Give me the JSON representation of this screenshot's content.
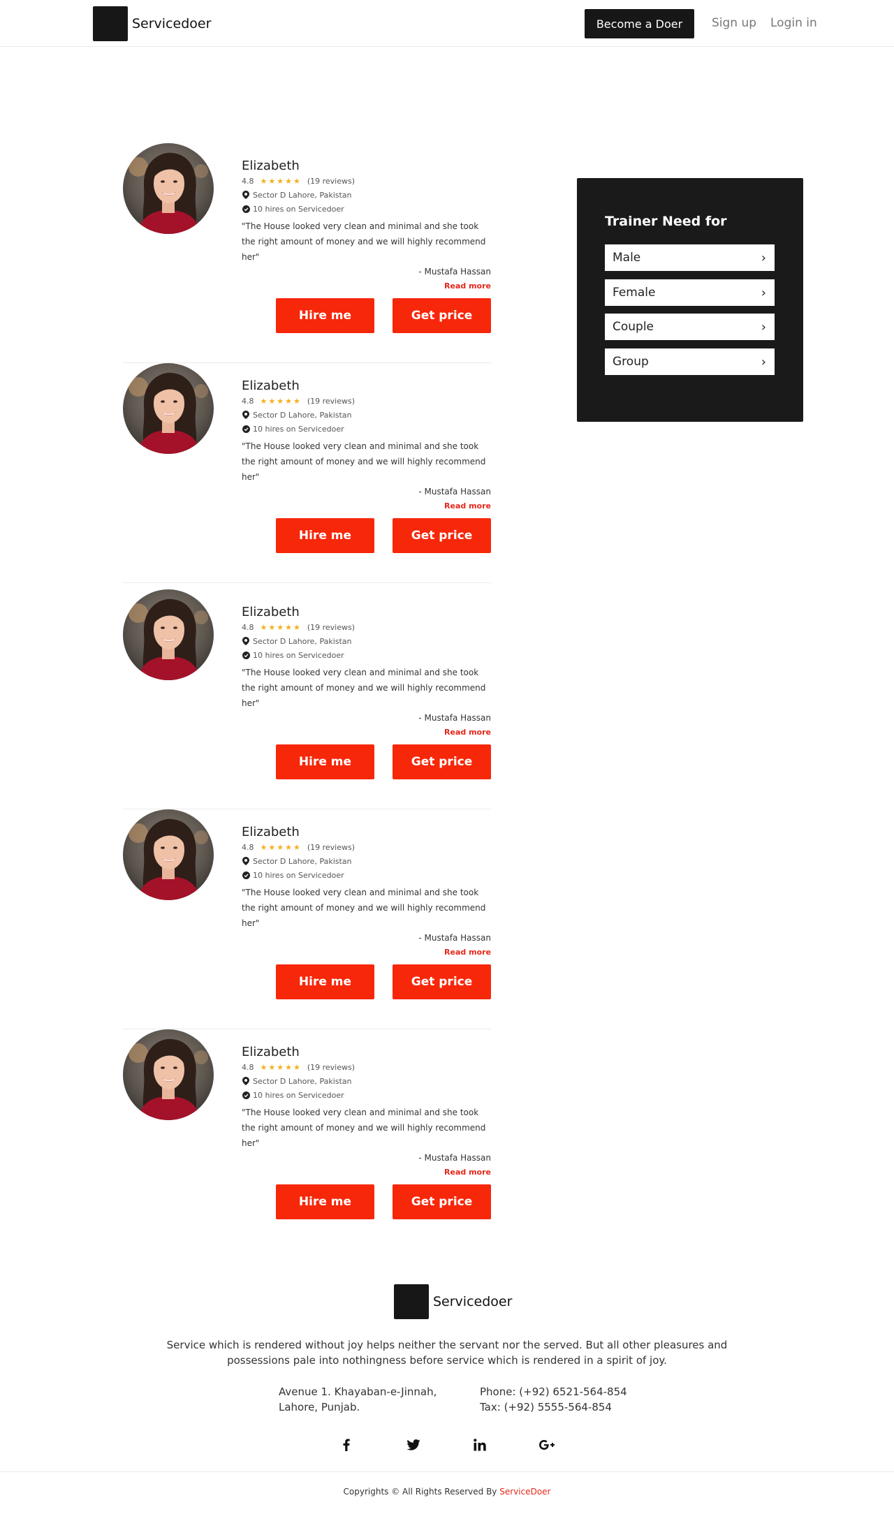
{
  "header": {
    "brand": "Servicedoer",
    "become_label": "Become a Doer",
    "signup_label": "Sign up",
    "login_label": "Login in"
  },
  "profiles": [
    {
      "name": "Elizabeth",
      "rating": "4.8",
      "stars": "★★★★★",
      "reviews": "(19 reviews)",
      "location": "Sector D Lahore, Pakistan",
      "hires": "10 hires on Servicedoer",
      "quote": "\"The House looked very clean and minimal and she took the right amount of money and we will highly recommend her\"",
      "author": "- Mustafa Hassan",
      "read_more": "Read more",
      "hire_label": "Hire me",
      "price_label": "Get price"
    },
    {
      "name": "Elizabeth",
      "rating": "4.8",
      "stars": "★★★★★",
      "reviews": "(19 reviews)",
      "location": "Sector D Lahore, Pakistan",
      "hires": "10 hires on Servicedoer",
      "quote": "\"The House looked very clean and minimal and she took the right amount of money and we will highly recommend her\"",
      "author": "- Mustafa Hassan",
      "read_more": "Read more",
      "hire_label": "Hire me",
      "price_label": "Get price"
    },
    {
      "name": "Elizabeth",
      "rating": "4.8",
      "stars": "★★★★★",
      "reviews": "(19 reviews)",
      "location": "Sector D Lahore, Pakistan",
      "hires": "10 hires on Servicedoer",
      "quote": "\"The House looked very clean and minimal and she took the right amount of money and we will highly recommend her\"",
      "author": "- Mustafa Hassan",
      "read_more": "Read more",
      "hire_label": "Hire me",
      "price_label": "Get price"
    },
    {
      "name": "Elizabeth",
      "rating": "4.8",
      "stars": "★★★★★",
      "reviews": "(19 reviews)",
      "location": "Sector D Lahore, Pakistan",
      "hires": "10 hires on Servicedoer",
      "quote": "\"The House looked very clean and minimal and she took the right amount of money and we will highly recommend her\"",
      "author": "- Mustafa Hassan",
      "read_more": "Read more",
      "hire_label": "Hire me",
      "price_label": "Get price"
    },
    {
      "name": "Elizabeth",
      "rating": "4.8",
      "stars": "★★★★★",
      "reviews": "(19 reviews)",
      "location": "Sector D Lahore, Pakistan",
      "hires": "10 hires on Servicedoer",
      "quote": "\"The House looked very clean and minimal and she took the right amount of money and we will highly recommend her\"",
      "author": "- Mustafa Hassan",
      "read_more": "Read more",
      "hire_label": "Hire me",
      "price_label": "Get price"
    }
  ],
  "sidebar": {
    "title": "Trainer Need for",
    "options": [
      "Male",
      "Female",
      "Couple",
      "Group"
    ]
  },
  "footer": {
    "brand": "Servicedoer",
    "tagline": "Service which is rendered without joy helps neither the servant nor the served. But all other pleasures and possessions pale into nothingness before service which is rendered in a spirit of joy.",
    "address_line1": "Avenue 1. Khayaban-e-Jinnah,",
    "address_line2": "Lahore, Punjab.",
    "phone": "Phone: (+92) 6521-564-854",
    "tax": "Tax: (+92) 5555-564-854",
    "social_icons": [
      "facebook-icon",
      "twitter-icon",
      "linkedin-icon",
      "google-plus-icon"
    ],
    "copyright_text": "Copyrights © All Rights Reserved By ",
    "copyright_brand": "ServiceDoer"
  },
  "colors": {
    "accent_red": "#f7270a",
    "dark": "#1a1a1a",
    "star": "#f2b01e"
  }
}
